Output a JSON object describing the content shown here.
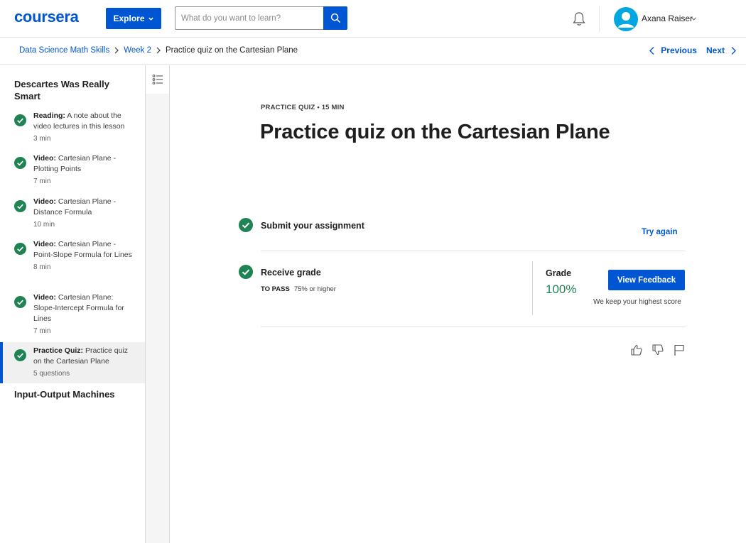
{
  "header": {
    "logo_text": "coursera",
    "explore_label": "Explore",
    "search_placeholder": "What do you want to learn?",
    "user_name": "Axana Raiser"
  },
  "breadcrumb": {
    "items": [
      "Data Science Math Skills",
      "Week 2"
    ],
    "current": "Practice quiz on the Cartesian Plane",
    "previous_label": "Previous",
    "next_label": "Next"
  },
  "sidebar": {
    "section1_title": "Descartes Was Really Smart",
    "lessons": [
      {
        "type": "Reading:",
        "title": "A note about the video lectures in this lesson",
        "duration": "3 min",
        "completed": true
      },
      {
        "type": "Video:",
        "title": "Cartesian Plane - Plotting Points",
        "duration": "7 min",
        "completed": true
      },
      {
        "type": "Video:",
        "title": "Cartesian Plane - Distance Formula",
        "duration": "10 min",
        "completed": true
      },
      {
        "type": "Video:",
        "title": "Cartesian Plane - Point-Slope Formula for Lines",
        "duration": "8 min",
        "completed": true
      },
      {
        "type": "Video:",
        "title": "Cartesian Plane: Slope-Intercept Formula for Lines",
        "duration": "7 min",
        "completed": true
      },
      {
        "type": "Practice Quiz:",
        "title": "Practice quiz on the Cartesian Plane",
        "duration": "5 questions",
        "completed": true,
        "active": true
      }
    ],
    "section2_title": "Input-Output Machines"
  },
  "main": {
    "kicker": "PRACTICE QUIZ • 15 MIN",
    "title": "Practice quiz on the Cartesian Plane",
    "submit_label": "Submit your assignment",
    "try_again_label": "Try again",
    "receive_label": "Receive grade",
    "to_pass_label": "TO PASS",
    "to_pass_value": "75% or higher",
    "grade_label": "Grade",
    "grade_value": "100%",
    "feedback_button": "View Feedback",
    "highest_note": "We keep your highest score"
  },
  "colors": {
    "brand": "#0056d2",
    "success": "#1f8354"
  },
  "icons": [
    "search-icon",
    "bell-icon",
    "chevron-down-icon",
    "chevron-left-icon",
    "chevron-right-icon",
    "check-circle-icon",
    "outline-list-icon",
    "thumbs-up-icon",
    "thumbs-down-icon",
    "flag-icon"
  ]
}
